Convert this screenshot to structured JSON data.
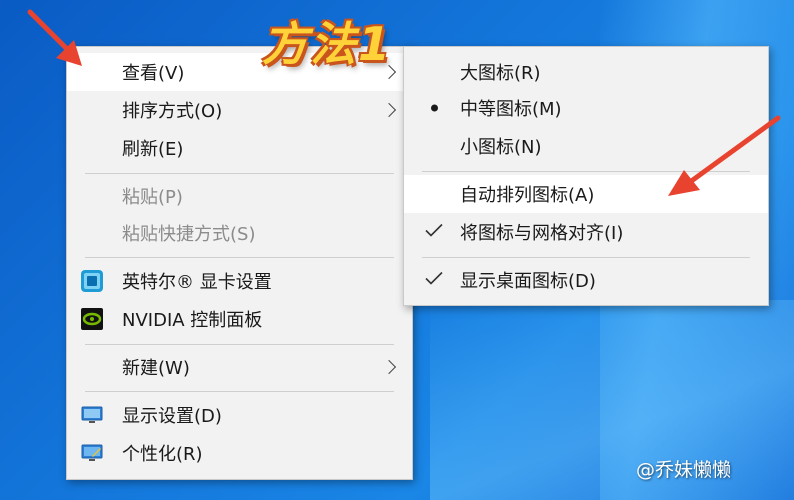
{
  "overlay_title": "方法1",
  "watermark": "@乔妹懒懒",
  "main_menu": {
    "view": "查看(V)",
    "sort": "排序方式(O)",
    "refresh": "刷新(E)",
    "paste": "粘贴(P)",
    "paste_shortcut": "粘贴快捷方式(S)",
    "intel": "英特尔® 显卡设置",
    "nvidia": "NVIDIA 控制面板",
    "new": "新建(W)",
    "display": "显示设置(D)",
    "personalize": "个性化(R)"
  },
  "sub_menu": {
    "large": "大图标(R)",
    "medium": "中等图标(M)",
    "small": "小图标(N)",
    "auto_arrange": "自动排列图标(A)",
    "align_grid": "将图标与网格对齐(I)",
    "show_desktop_icons": "显示桌面图标(D)"
  },
  "colors": {
    "arrow_red": "#e8432f",
    "title_yellow": "#ffd23a",
    "title_outline": "#c9541c"
  },
  "icons": {
    "intel": "intel-graphics-icon",
    "nvidia": "nvidia-icon",
    "display": "display-settings-icon",
    "personalize": "personalize-icon",
    "selected_bullet": "bullet-dot-icon",
    "checked": "checkmark-icon"
  }
}
